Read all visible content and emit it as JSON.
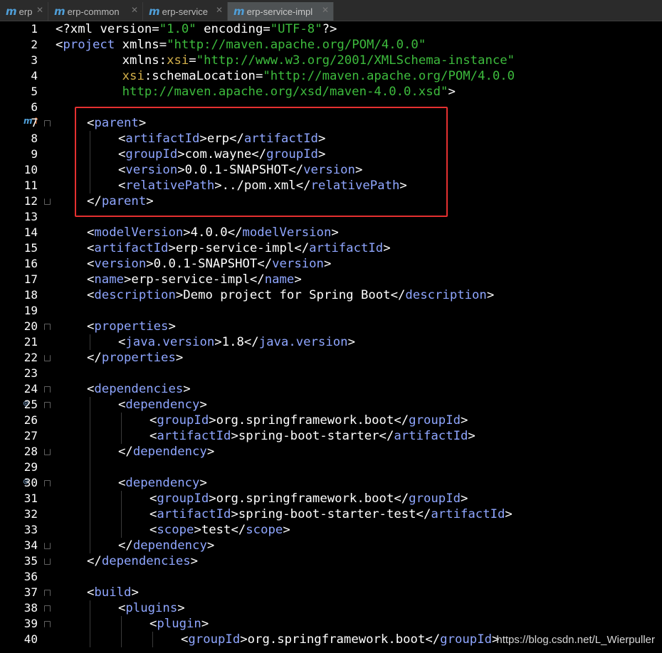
{
  "tabs": [
    {
      "icon": "m",
      "label": "erp",
      "active": false
    },
    {
      "icon": "m",
      "label": "erp-common",
      "active": false
    },
    {
      "icon": "m",
      "label": "erp-service",
      "active": false
    },
    {
      "icon": "m",
      "label": "erp-service-impl",
      "active": true
    }
  ],
  "editor": {
    "lines": [
      {
        "n": "1",
        "indent": 0,
        "tokens": [
          [
            "t",
            "<?xml "
          ],
          [
            "an",
            "version"
          ],
          [
            "t",
            "="
          ],
          [
            "av",
            "\"1.0\""
          ],
          [
            "t",
            " "
          ],
          [
            "an",
            "encoding"
          ],
          [
            "t",
            "="
          ],
          [
            "av",
            "\"UTF-8\""
          ],
          [
            "t",
            "?>"
          ]
        ]
      },
      {
        "n": "2",
        "indent": 0,
        "tokens": [
          [
            "t",
            "<"
          ],
          [
            "tn",
            "project"
          ],
          [
            "t",
            " "
          ],
          [
            "an",
            "xmlns"
          ],
          [
            "t",
            "="
          ],
          [
            "av",
            "\"http://maven.apache.org/POM/4.0.0\""
          ]
        ]
      },
      {
        "n": "3",
        "indent": 0,
        "tokens": [
          [
            "t",
            "         "
          ],
          [
            "an",
            "xmlns"
          ],
          [
            "t",
            ":"
          ],
          [
            "ans",
            "xsi"
          ],
          [
            "t",
            "="
          ],
          [
            "av",
            "\"http://www.w3.org/2001/XMLSchema-instance\""
          ]
        ]
      },
      {
        "n": "4",
        "indent": 0,
        "tokens": [
          [
            "t",
            "         "
          ],
          [
            "ans",
            "xsi"
          ],
          [
            "t",
            ":"
          ],
          [
            "an",
            "schemaLocation"
          ],
          [
            "t",
            "="
          ],
          [
            "av",
            "\"http://maven.apache.org/POM/4.0.0"
          ]
        ]
      },
      {
        "n": "5",
        "indent": 0,
        "tokens": [
          [
            "av",
            "         http://maven.apache.org/xsd/maven-4.0.0.xsd\""
          ],
          [
            "t",
            ">"
          ]
        ]
      },
      {
        "n": "6",
        "indent": 0,
        "tokens": []
      },
      {
        "n": "7",
        "indent": 1,
        "tokens": [
          [
            "t",
            "<"
          ],
          [
            "tn",
            "parent"
          ],
          [
            "t",
            ">"
          ]
        ]
      },
      {
        "n": "8",
        "indent": 2,
        "tokens": [
          [
            "t",
            "<"
          ],
          [
            "tn",
            "artifactId"
          ],
          [
            "t",
            ">erp</"
          ],
          [
            "tn",
            "artifactId"
          ],
          [
            "t",
            ">"
          ]
        ]
      },
      {
        "n": "9",
        "indent": 2,
        "tokens": [
          [
            "t",
            "<"
          ],
          [
            "tn",
            "groupId"
          ],
          [
            "t",
            ">com.wayne</"
          ],
          [
            "tn",
            "groupId"
          ],
          [
            "t",
            ">"
          ]
        ]
      },
      {
        "n": "10",
        "indent": 2,
        "tokens": [
          [
            "t",
            "<"
          ],
          [
            "tn",
            "version"
          ],
          [
            "t",
            ">0.0.1-SNAPSHOT</"
          ],
          [
            "tn",
            "version"
          ],
          [
            "t",
            ">"
          ]
        ]
      },
      {
        "n": "11",
        "indent": 2,
        "tokens": [
          [
            "t",
            "<"
          ],
          [
            "tn",
            "relativePath"
          ],
          [
            "t",
            ">../pom.xml</"
          ],
          [
            "tn",
            "relativePath"
          ],
          [
            "t",
            ">"
          ]
        ]
      },
      {
        "n": "12",
        "indent": 1,
        "tokens": [
          [
            "t",
            "</"
          ],
          [
            "tn",
            "parent"
          ],
          [
            "t",
            ">"
          ]
        ]
      },
      {
        "n": "13",
        "indent": 0,
        "tokens": []
      },
      {
        "n": "14",
        "indent": 1,
        "tokens": [
          [
            "t",
            "<"
          ],
          [
            "tn",
            "modelVersion"
          ],
          [
            "t",
            ">4.0.0</"
          ],
          [
            "tn",
            "modelVersion"
          ],
          [
            "t",
            ">"
          ]
        ]
      },
      {
        "n": "15",
        "indent": 1,
        "tokens": [
          [
            "t",
            "<"
          ],
          [
            "tn",
            "artifactId"
          ],
          [
            "t",
            ">erp-service-impl</"
          ],
          [
            "tn",
            "artifactId"
          ],
          [
            "t",
            ">"
          ]
        ]
      },
      {
        "n": "16",
        "indent": 1,
        "tokens": [
          [
            "t",
            "<"
          ],
          [
            "tn",
            "version"
          ],
          [
            "t",
            ">0.0.1-SNAPSHOT</"
          ],
          [
            "tn",
            "version"
          ],
          [
            "t",
            ">"
          ]
        ]
      },
      {
        "n": "17",
        "indent": 1,
        "tokens": [
          [
            "t",
            "<"
          ],
          [
            "tn",
            "name"
          ],
          [
            "t",
            ">erp-service-impl</"
          ],
          [
            "tn",
            "name"
          ],
          [
            "t",
            ">"
          ]
        ]
      },
      {
        "n": "18",
        "indent": 1,
        "tokens": [
          [
            "t",
            "<"
          ],
          [
            "tn",
            "description"
          ],
          [
            "t",
            ">Demo project for Spring Boot</"
          ],
          [
            "tn",
            "description"
          ],
          [
            "t",
            ">"
          ]
        ]
      },
      {
        "n": "19",
        "indent": 0,
        "tokens": []
      },
      {
        "n": "20",
        "indent": 1,
        "tokens": [
          [
            "t",
            "<"
          ],
          [
            "tn",
            "properties"
          ],
          [
            "t",
            ">"
          ]
        ]
      },
      {
        "n": "21",
        "indent": 2,
        "tokens": [
          [
            "t",
            "<"
          ],
          [
            "tn",
            "java.version"
          ],
          [
            "t",
            ">1.8</"
          ],
          [
            "tn",
            "java.version"
          ],
          [
            "t",
            ">"
          ]
        ]
      },
      {
        "n": "22",
        "indent": 1,
        "tokens": [
          [
            "t",
            "</"
          ],
          [
            "tn",
            "properties"
          ],
          [
            "t",
            ">"
          ]
        ]
      },
      {
        "n": "23",
        "indent": 0,
        "tokens": []
      },
      {
        "n": "24",
        "indent": 1,
        "tokens": [
          [
            "t",
            "<"
          ],
          [
            "tn",
            "dependencies"
          ],
          [
            "t",
            ">"
          ]
        ]
      },
      {
        "n": "25",
        "indent": 2,
        "tokens": [
          [
            "t",
            "<"
          ],
          [
            "tn",
            "dependency"
          ],
          [
            "t",
            ">"
          ]
        ]
      },
      {
        "n": "26",
        "indent": 3,
        "tokens": [
          [
            "t",
            "<"
          ],
          [
            "tn",
            "groupId"
          ],
          [
            "t",
            ">org.springframework.boot</"
          ],
          [
            "tn",
            "groupId"
          ],
          [
            "t",
            ">"
          ]
        ]
      },
      {
        "n": "27",
        "indent": 3,
        "tokens": [
          [
            "t",
            "<"
          ],
          [
            "tn",
            "artifactId"
          ],
          [
            "t",
            ">spring-boot-starter</"
          ],
          [
            "tn",
            "artifactId"
          ],
          [
            "t",
            ">"
          ]
        ]
      },
      {
        "n": "28",
        "indent": 2,
        "tokens": [
          [
            "t",
            "</"
          ],
          [
            "tn",
            "dependency"
          ],
          [
            "t",
            ">"
          ]
        ]
      },
      {
        "n": "29",
        "indent": 0,
        "tokens": []
      },
      {
        "n": "30",
        "indent": 2,
        "tokens": [
          [
            "t",
            "<"
          ],
          [
            "tn",
            "dependency"
          ],
          [
            "t",
            ">"
          ]
        ]
      },
      {
        "n": "31",
        "indent": 3,
        "tokens": [
          [
            "t",
            "<"
          ],
          [
            "tn",
            "groupId"
          ],
          [
            "t",
            ">org.springframework.boot</"
          ],
          [
            "tn",
            "groupId"
          ],
          [
            "t",
            ">"
          ]
        ]
      },
      {
        "n": "32",
        "indent": 3,
        "tokens": [
          [
            "t",
            "<"
          ],
          [
            "tn",
            "artifactId"
          ],
          [
            "t",
            ">spring-boot-starter-test</"
          ],
          [
            "tn",
            "artifactId"
          ],
          [
            "t",
            ">"
          ]
        ]
      },
      {
        "n": "33",
        "indent": 3,
        "tokens": [
          [
            "t",
            "<"
          ],
          [
            "tn",
            "scope"
          ],
          [
            "t",
            ">test</"
          ],
          [
            "tn",
            "scope"
          ],
          [
            "t",
            ">"
          ]
        ]
      },
      {
        "n": "34",
        "indent": 2,
        "tokens": [
          [
            "t",
            "</"
          ],
          [
            "tn",
            "dependency"
          ],
          [
            "t",
            ">"
          ]
        ]
      },
      {
        "n": "35",
        "indent": 1,
        "tokens": [
          [
            "t",
            "</"
          ],
          [
            "tn",
            "dependencies"
          ],
          [
            "t",
            ">"
          ]
        ]
      },
      {
        "n": "36",
        "indent": 0,
        "tokens": []
      },
      {
        "n": "37",
        "indent": 1,
        "tokens": [
          [
            "t",
            "<"
          ],
          [
            "tn",
            "build"
          ],
          [
            "t",
            ">"
          ]
        ]
      },
      {
        "n": "38",
        "indent": 2,
        "tokens": [
          [
            "t",
            "<"
          ],
          [
            "tn",
            "plugins"
          ],
          [
            "t",
            ">"
          ]
        ]
      },
      {
        "n": "39",
        "indent": 3,
        "tokens": [
          [
            "t",
            "<"
          ],
          [
            "tn",
            "plugin"
          ],
          [
            "t",
            ">"
          ]
        ]
      },
      {
        "n": "40",
        "indent": 4,
        "tokens": [
          [
            "t",
            "<"
          ],
          [
            "tn",
            "groupId"
          ],
          [
            "t",
            ">org.springframework.boot</"
          ],
          [
            "tn",
            "groupId"
          ],
          [
            "t",
            ">"
          ]
        ]
      }
    ]
  },
  "watermark": "https://blog.csdn.net/L_Wierpuller",
  "colors": {
    "background": "#000000",
    "tag_name": "#8fa6ff",
    "attr_value": "#3dbb3d",
    "namespace": "#d4b04a",
    "highlight_box": "#e53030"
  }
}
